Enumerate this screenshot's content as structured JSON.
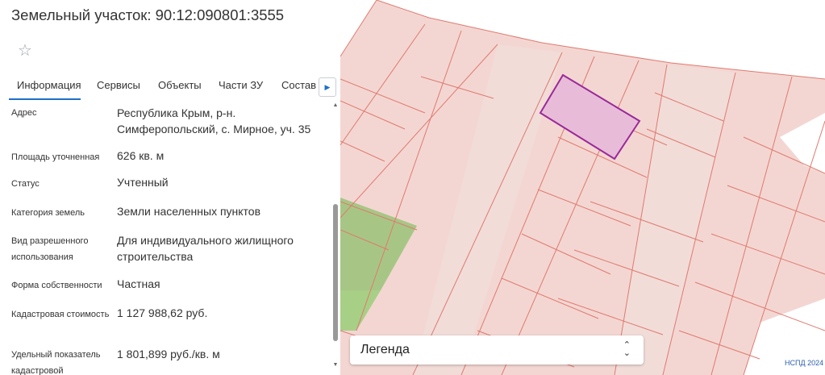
{
  "header": {
    "title": "Земельный участок: 90:12:090801:3555"
  },
  "tabs": [
    {
      "label": "Информация"
    },
    {
      "label": "Сервисы"
    },
    {
      "label": "Объекты"
    },
    {
      "label": "Части ЗУ"
    },
    {
      "label": "Состав"
    }
  ],
  "details": [
    {
      "label": "Адрес",
      "value": "Республика Крым, р-н. Симферопольский, с. Мирное, уч. 35"
    },
    {
      "label": "Площадь уточненная",
      "value": "626 кв. м"
    },
    {
      "label": "Статус",
      "value": "Учтенный"
    },
    {
      "label": "Категория земель",
      "value": "Земли населенных пунктов"
    },
    {
      "label": "Вид разрешенного использования",
      "value": "Для индивидуального жилищного строительства"
    },
    {
      "label": "Форма собственности",
      "value": "Частная"
    },
    {
      "label": "Кадастровая стоимость",
      "value": "1 127 988,62 руб."
    },
    {
      "label": "Удельный показатель кадастровой",
      "value": "1 801,899 руб./кв. м"
    }
  ],
  "map": {
    "legend_label": "Легенда",
    "copyright": "НСПД 2024",
    "colors": {
      "parcel_fill": "#f3d6d2",
      "parcel_stroke": "#e07a6f",
      "selected_fill": "#e8bcd8",
      "selected_stroke": "#9a2a9a",
      "green": "#9fc47c"
    }
  }
}
